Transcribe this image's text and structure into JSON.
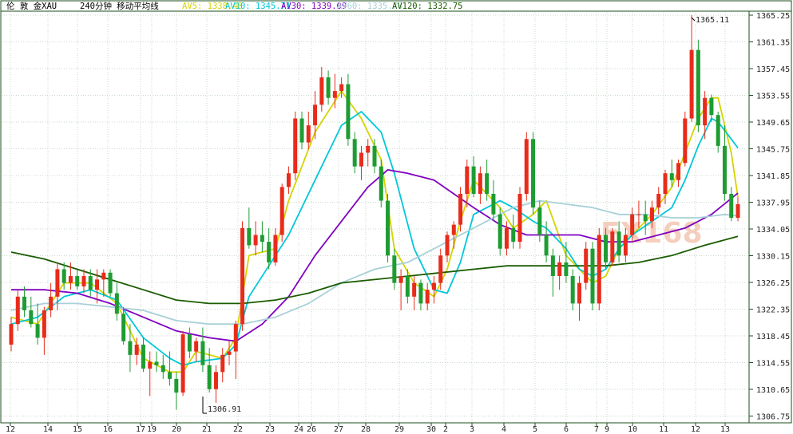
{
  "header": {
    "instrument": "伦 敦 金XAU",
    "period": "240分钟 移动平均线",
    "ma": [
      {
        "label": "AV5:",
        "value": "1338.48",
        "color": "#d4d400"
      },
      {
        "label": "AV10:",
        "value": "1345.71",
        "color": "#00c8d8"
      },
      {
        "label": "AV30:",
        "value": "1339.09",
        "color": "#8000c0"
      },
      {
        "label": "AV60:",
        "value": "1335.78",
        "color": "#a8d0d8"
      },
      {
        "label": "AV120:",
        "value": "1332.75",
        "color": "#1a5c00"
      }
    ]
  },
  "watermark": "FX168",
  "annotations": {
    "high": "1365.11",
    "low": "1306.91"
  },
  "chart_data": {
    "type": "candlestick",
    "yticks": [
      "1365.25",
      "1361.35",
      "1357.45",
      "1353.55",
      "1349.65",
      "1345.75",
      "1341.85",
      "1337.95",
      "1334.05",
      "1330.15",
      "1326.25",
      "1322.35",
      "1318.45",
      "1314.55",
      "1310.65",
      "1306.75"
    ],
    "ylim": [
      1305.5,
      1366.5
    ],
    "xticks": [
      "12",
      "14",
      "15",
      "16",
      "17",
      "19",
      "20",
      "21",
      "22",
      "23",
      "24",
      "26",
      "27",
      "28",
      "29",
      "30",
      "2",
      "3",
      "4",
      "5",
      "6",
      "7",
      "9",
      "10",
      "11",
      "12",
      "13"
    ],
    "up_color": "#e82b1a",
    "down_color": "#1e9c32",
    "candles": [
      [
        1317,
        1321,
        1316,
        1320
      ],
      [
        1320,
        1325,
        1319,
        1324
      ],
      [
        1324,
        1325.5,
        1321,
        1322
      ],
      [
        1322,
        1324,
        1319.5,
        1320
      ],
      [
        1320,
        1323,
        1317,
        1318
      ],
      [
        1318,
        1322.5,
        1315.5,
        1322
      ],
      [
        1322,
        1326,
        1321,
        1324
      ],
      [
        1324,
        1329,
        1322,
        1328
      ],
      [
        1328,
        1329,
        1325,
        1326
      ],
      [
        1326,
        1329,
        1325,
        1327
      ],
      [
        1327,
        1328,
        1325,
        1325.5
      ],
      [
        1325.5,
        1328,
        1324.5,
        1327
      ],
      [
        1327,
        1328,
        1324,
        1325
      ],
      [
        1325,
        1328,
        1323,
        1326.5
      ],
      [
        1326.5,
        1328,
        1324,
        1327.5
      ],
      [
        1327.5,
        1328,
        1324,
        1324.5
      ],
      [
        1324.5,
        1326,
        1320.5,
        1321.5
      ],
      [
        1321.5,
        1322.5,
        1317,
        1317.5
      ],
      [
        1317.5,
        1320,
        1313,
        1315.5
      ],
      [
        1315.5,
        1318,
        1314,
        1317
      ],
      [
        1317,
        1318,
        1313,
        1313.5
      ],
      [
        1313.5,
        1316,
        1309.5,
        1314.5
      ],
      [
        1314.5,
        1316,
        1313,
        1314
      ],
      [
        1314,
        1315.5,
        1312,
        1313
      ],
      [
        1313,
        1316,
        1311,
        1312
      ],
      [
        1312,
        1313,
        1307.5,
        1310
      ],
      [
        1310,
        1319,
        1309.5,
        1318.5
      ],
      [
        1318.5,
        1319.5,
        1315,
        1316
      ],
      [
        1316,
        1318,
        1314.5,
        1317.5
      ],
      [
        1317.5,
        1319.5,
        1313,
        1314
      ],
      [
        1314,
        1316.5,
        1310,
        1310.5
      ],
      [
        1310.5,
        1314,
        1308.5,
        1313
      ],
      [
        1313,
        1316.5,
        1311.5,
        1315.5
      ],
      [
        1315.5,
        1317.5,
        1314,
        1316
      ],
      [
        1316,
        1320.5,
        1312,
        1320
      ],
      [
        1320,
        1335,
        1319,
        1334
      ],
      [
        1334,
        1337,
        1331,
        1331.5
      ],
      [
        1331.5,
        1335,
        1330,
        1333
      ],
      [
        1333,
        1335,
        1330.5,
        1332
      ],
      [
        1332,
        1334,
        1328,
        1329
      ],
      [
        1329,
        1334,
        1328.5,
        1333
      ],
      [
        1333,
        1340.5,
        1332,
        1340
      ],
      [
        1340,
        1343,
        1339,
        1342
      ],
      [
        1342,
        1351,
        1341,
        1350
      ],
      [
        1350,
        1351,
        1345.5,
        1346.5
      ],
      [
        1346.5,
        1351,
        1345.5,
        1349
      ],
      [
        1349,
        1354,
        1347,
        1352
      ],
      [
        1352,
        1357.5,
        1351,
        1356
      ],
      [
        1356,
        1357,
        1352,
        1353
      ],
      [
        1353,
        1356.5,
        1351.5,
        1354
      ],
      [
        1354,
        1356,
        1353,
        1355
      ],
      [
        1355,
        1356.5,
        1346,
        1347
      ],
      [
        1347,
        1348,
        1342,
        1343
      ],
      [
        1343,
        1346,
        1341,
        1345
      ],
      [
        1345,
        1347,
        1343,
        1346
      ],
      [
        1346,
        1347,
        1342,
        1343
      ],
      [
        1343,
        1344,
        1337,
        1338
      ],
      [
        1338,
        1339,
        1329,
        1330
      ],
      [
        1330,
        1331,
        1325,
        1326
      ],
      [
        1326,
        1328,
        1322,
        1327
      ],
      [
        1327,
        1328,
        1323,
        1324
      ],
      [
        1324,
        1327,
        1322,
        1326
      ],
      [
        1326,
        1326.5,
        1322,
        1323
      ],
      [
        1323,
        1326,
        1322,
        1325
      ],
      [
        1325,
        1327,
        1323,
        1326
      ],
      [
        1326,
        1331,
        1325,
        1330
      ],
      [
        1330,
        1333.5,
        1329,
        1333
      ],
      [
        1333,
        1335,
        1331,
        1334.5
      ],
      [
        1334.5,
        1340,
        1333.5,
        1339
      ],
      [
        1339,
        1344,
        1337,
        1343
      ],
      [
        1343,
        1344.5,
        1338.5,
        1339
      ],
      [
        1339,
        1343,
        1337.5,
        1342
      ],
      [
        1342,
        1344,
        1338,
        1339
      ],
      [
        1339,
        1341,
        1335,
        1336
      ],
      [
        1336,
        1337,
        1330,
        1331
      ],
      [
        1331,
        1335,
        1330,
        1334
      ],
      [
        1334,
        1336,
        1331,
        1332
      ],
      [
        1332,
        1340,
        1331,
        1339
      ],
      [
        1339,
        1348,
        1338,
        1347
      ],
      [
        1347,
        1348,
        1336,
        1337
      ],
      [
        1337,
        1338,
        1332,
        1333
      ],
      [
        1333,
        1335,
        1329,
        1330
      ],
      [
        1330,
        1331,
        1324,
        1327
      ],
      [
        1327,
        1330,
        1325,
        1329
      ],
      [
        1329,
        1332,
        1326,
        1327
      ],
      [
        1327,
        1328,
        1322,
        1323
      ],
      [
        1323,
        1327,
        1320.5,
        1326
      ],
      [
        1326,
        1332,
        1325,
        1331
      ],
      [
        1331,
        1332,
        1322,
        1323
      ],
      [
        1323,
        1334,
        1322,
        1333
      ],
      [
        1333,
        1334,
        1328,
        1329
      ],
      [
        1329,
        1334,
        1328.5,
        1333.5
      ],
      [
        1333.5,
        1335,
        1329,
        1330
      ],
      [
        1330,
        1334,
        1329,
        1333
      ],
      [
        1333,
        1337,
        1332,
        1336
      ],
      [
        1336,
        1338,
        1334,
        1336
      ],
      [
        1336,
        1338,
        1333,
        1335
      ],
      [
        1335,
        1338,
        1334,
        1337
      ],
      [
        1337,
        1340,
        1336,
        1339
      ],
      [
        1339,
        1342.5,
        1337.5,
        1342
      ],
      [
        1342,
        1344,
        1340,
        1341
      ],
      [
        1341,
        1344,
        1340,
        1343.5
      ],
      [
        1343.5,
        1351,
        1343,
        1350
      ],
      [
        1350,
        1365.1,
        1349.5,
        1360
      ],
      [
        1360,
        1361.5,
        1348,
        1349
      ],
      [
        1349,
        1354,
        1347,
        1353
      ],
      [
        1353,
        1353.5,
        1349.5,
        1350.5
      ],
      [
        1350.5,
        1351,
        1345,
        1346
      ],
      [
        1346,
        1349,
        1338,
        1339
      ],
      [
        1339,
        1340,
        1335,
        1335.5
      ],
      [
        1335.5,
        1338.5,
        1335,
        1337.5
      ]
    ],
    "moving_averages": [
      {
        "name": "AV5",
        "color": "#d4d400",
        "points": [
          [
            0,
            1321
          ],
          [
            4,
            1320
          ],
          [
            8,
            1326
          ],
          [
            12,
            1326
          ],
          [
            16,
            1323
          ],
          [
            20,
            1315
          ],
          [
            24,
            1313
          ],
          [
            26,
            1313
          ],
          [
            28,
            1316
          ],
          [
            32,
            1315
          ],
          [
            34,
            1318
          ],
          [
            36,
            1330
          ],
          [
            40,
            1331
          ],
          [
            42,
            1338
          ],
          [
            46,
            1348
          ],
          [
            50,
            1354
          ],
          [
            53,
            1350
          ],
          [
            56,
            1344
          ],
          [
            58,
            1331
          ],
          [
            61,
            1326
          ],
          [
            64,
            1324
          ],
          [
            66,
            1328
          ],
          [
            68,
            1335
          ],
          [
            70,
            1341
          ],
          [
            74,
            1337
          ],
          [
            76,
            1334
          ],
          [
            79,
            1336
          ],
          [
            81,
            1338
          ],
          [
            84,
            1330
          ],
          [
            86,
            1328
          ],
          [
            88,
            1326
          ],
          [
            90,
            1327
          ],
          [
            92,
            1331
          ],
          [
            94,
            1333
          ],
          [
            97,
            1336
          ],
          [
            100,
            1340
          ],
          [
            102,
            1345
          ],
          [
            104,
            1350
          ],
          [
            106,
            1353
          ],
          [
            107,
            1353
          ],
          [
            109,
            1345
          ],
          [
            110,
            1338.5
          ]
        ]
      },
      {
        "name": "AV10",
        "color": "#00c8d8",
        "points": [
          [
            0,
            1320
          ],
          [
            4,
            1321
          ],
          [
            8,
            1324
          ],
          [
            12,
            1325
          ],
          [
            16,
            1323.5
          ],
          [
            20,
            1318
          ],
          [
            24,
            1315
          ],
          [
            26,
            1314
          ],
          [
            28,
            1314.5
          ],
          [
            32,
            1315
          ],
          [
            34,
            1317
          ],
          [
            36,
            1324
          ],
          [
            40,
            1330
          ],
          [
            42,
            1333
          ],
          [
            46,
            1341
          ],
          [
            50,
            1349
          ],
          [
            53,
            1351
          ],
          [
            56,
            1348
          ],
          [
            58,
            1342
          ],
          [
            61,
            1331
          ],
          [
            64,
            1325
          ],
          [
            66,
            1324.5
          ],
          [
            68,
            1329
          ],
          [
            70,
            1336
          ],
          [
            74,
            1338
          ],
          [
            76,
            1337
          ],
          [
            79,
            1335
          ],
          [
            81,
            1334
          ],
          [
            84,
            1331
          ],
          [
            86,
            1328
          ],
          [
            88,
            1327
          ],
          [
            90,
            1328
          ],
          [
            92,
            1331
          ],
          [
            94,
            1333
          ],
          [
            97,
            1335
          ],
          [
            100,
            1337
          ],
          [
            102,
            1341
          ],
          [
            104,
            1346
          ],
          [
            106,
            1350
          ],
          [
            107,
            1349.5
          ],
          [
            109,
            1347
          ],
          [
            110,
            1345.7
          ]
        ]
      },
      {
        "name": "AV30",
        "color": "#8000c0",
        "points": [
          [
            0,
            1325
          ],
          [
            5,
            1325
          ],
          [
            10,
            1324.5
          ],
          [
            15,
            1323
          ],
          [
            20,
            1321
          ],
          [
            25,
            1319
          ],
          [
            30,
            1318
          ],
          [
            34,
            1317.5
          ],
          [
            38,
            1320
          ],
          [
            42,
            1324
          ],
          [
            46,
            1330
          ],
          [
            50,
            1335
          ],
          [
            54,
            1340
          ],
          [
            57,
            1342.5
          ],
          [
            60,
            1342
          ],
          [
            64,
            1341
          ],
          [
            67,
            1339
          ],
          [
            70,
            1337
          ],
          [
            74,
            1334.5
          ],
          [
            78,
            1333
          ],
          [
            82,
            1333
          ],
          [
            86,
            1333
          ],
          [
            90,
            1332
          ],
          [
            94,
            1332
          ],
          [
            98,
            1333
          ],
          [
            102,
            1334
          ],
          [
            106,
            1336
          ],
          [
            110,
            1339.1
          ]
        ]
      },
      {
        "name": "AV60",
        "color": "#a8d0d8",
        "points": [
          [
            0,
            1322
          ],
          [
            5,
            1323
          ],
          [
            10,
            1323
          ],
          [
            15,
            1322.5
          ],
          [
            20,
            1322
          ],
          [
            25,
            1320.5
          ],
          [
            30,
            1320
          ],
          [
            35,
            1320
          ],
          [
            40,
            1321
          ],
          [
            45,
            1323
          ],
          [
            50,
            1326
          ],
          [
            55,
            1328
          ],
          [
            60,
            1329
          ],
          [
            64,
            1331
          ],
          [
            68,
            1333
          ],
          [
            72,
            1335
          ],
          [
            76,
            1337
          ],
          [
            80,
            1338
          ],
          [
            84,
            1337.5
          ],
          [
            88,
            1337
          ],
          [
            92,
            1336
          ],
          [
            96,
            1336
          ],
          [
            100,
            1335.5
          ],
          [
            104,
            1335.5
          ],
          [
            108,
            1336
          ],
          [
            110,
            1335.8
          ]
        ]
      },
      {
        "name": "AV120",
        "color": "#1a5c00",
        "points": [
          [
            0,
            1330.5
          ],
          [
            5,
            1329.5
          ],
          [
            10,
            1328
          ],
          [
            15,
            1326.5
          ],
          [
            20,
            1325
          ],
          [
            25,
            1323.5
          ],
          [
            30,
            1323
          ],
          [
            35,
            1323
          ],
          [
            40,
            1323.5
          ],
          [
            45,
            1324.5
          ],
          [
            50,
            1326
          ],
          [
            55,
            1326.5
          ],
          [
            60,
            1327
          ],
          [
            65,
            1327.5
          ],
          [
            70,
            1328
          ],
          [
            75,
            1328.5
          ],
          [
            80,
            1328.5
          ],
          [
            85,
            1328.5
          ],
          [
            90,
            1328.5
          ],
          [
            95,
            1329
          ],
          [
            100,
            1330
          ],
          [
            105,
            1331.5
          ],
          [
            110,
            1332.8
          ]
        ]
      }
    ]
  }
}
